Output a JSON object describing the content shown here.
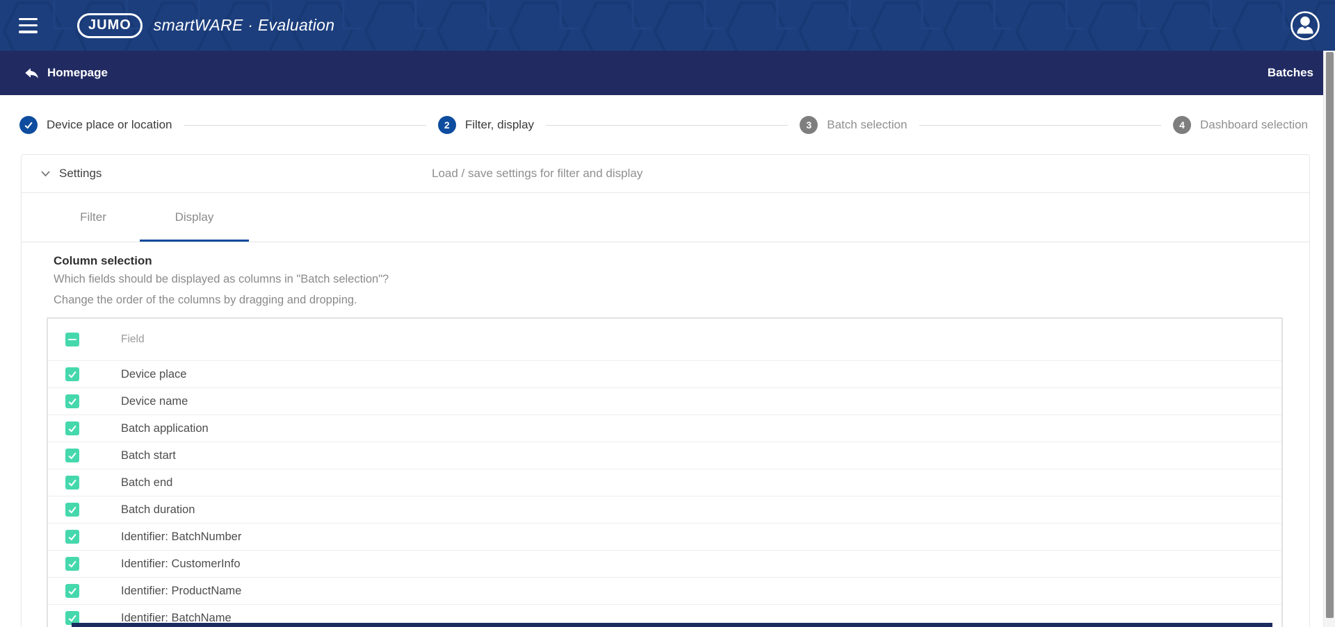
{
  "colors": {
    "header_bg": "#1C3E7D",
    "subheader_bg": "#212B62",
    "primary_blue": "#0D4C9E",
    "accent_teal": "#46D8AD",
    "inactive_gray": "#8F8F8F"
  },
  "header": {
    "brand_label": "JUMO",
    "product_label": "smartWARE · Evaluation"
  },
  "subheader": {
    "back_label": "Homepage",
    "right_label": "Batches"
  },
  "stepper": {
    "steps": [
      {
        "number": "1",
        "label": "Device place or location",
        "state": "done"
      },
      {
        "number": "2",
        "label": "Filter, display",
        "state": "active"
      },
      {
        "number": "3",
        "label": "Batch selection",
        "state": "upcoming"
      },
      {
        "number": "4",
        "label": "Dashboard selection",
        "state": "upcoming"
      }
    ]
  },
  "settings_panel": {
    "title": "Settings",
    "description": "Load / save settings for filter and display"
  },
  "tabs": [
    {
      "label": "Filter",
      "active": false
    },
    {
      "label": "Display",
      "active": true
    }
  ],
  "column_selection": {
    "title": "Column selection",
    "question": "Which fields should be displayed as columns in \"Batch selection\"?",
    "hint": "Change the order of the columns by dragging and dropping."
  },
  "table": {
    "header": {
      "select_all_state": "indeterminate",
      "field_label": "Field"
    },
    "rows": [
      {
        "label": "Device place",
        "checked": true
      },
      {
        "label": "Device name",
        "checked": true
      },
      {
        "label": "Batch application",
        "checked": true
      },
      {
        "label": "Batch start",
        "checked": true
      },
      {
        "label": "Batch end",
        "checked": true
      },
      {
        "label": "Batch duration",
        "checked": true
      },
      {
        "label": "Identifier: BatchNumber",
        "checked": true
      },
      {
        "label": "Identifier: CustomerInfo",
        "checked": true
      },
      {
        "label": "Identifier: ProductName",
        "checked": true
      },
      {
        "label": "Identifier: BatchName",
        "checked": true
      }
    ]
  }
}
